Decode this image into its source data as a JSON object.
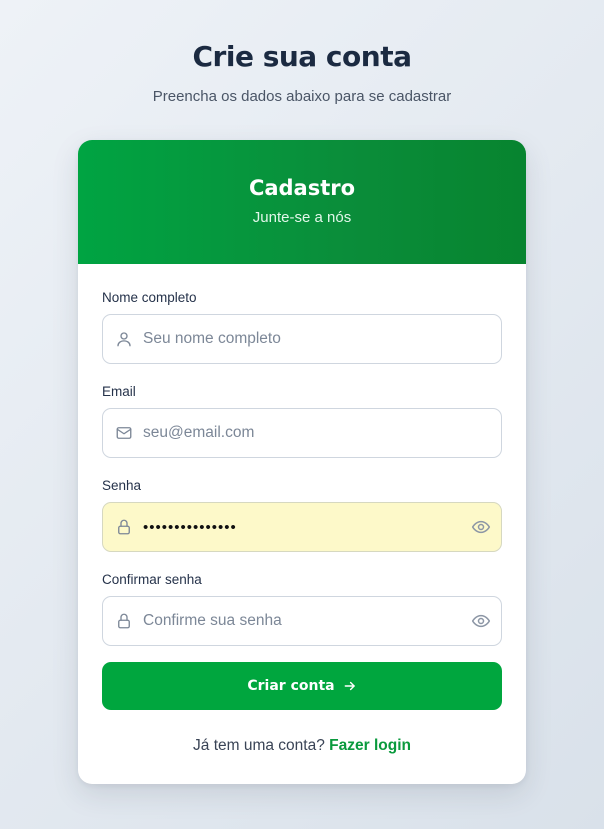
{
  "page": {
    "title": "Crie sua conta",
    "subtitle": "Preencha os dados abaixo para se cadastrar"
  },
  "card": {
    "title": "Cadastro",
    "subtitle": "Junte-se a nós"
  },
  "form": {
    "name": {
      "label": "Nome completo",
      "placeholder": "Seu nome completo",
      "value": ""
    },
    "email": {
      "label": "Email",
      "placeholder": "seu@email.com",
      "value": ""
    },
    "password": {
      "label": "Senha",
      "placeholder": "",
      "value": "•••••••••••••••"
    },
    "confirm_password": {
      "label": "Confirmar senha",
      "placeholder": "Confirme sua senha",
      "value": ""
    },
    "submit_label": "Criar conta"
  },
  "footer": {
    "prompt": "Já tem uma conta?",
    "login_link": "Fazer login"
  },
  "icons": {
    "name": "user-icon",
    "email": "mail-icon",
    "password": "lock-icon",
    "confirm_password": "lock-icon",
    "toggle": "eye-icon",
    "submit": "arrow-right-icon"
  },
  "colors": {
    "primary": "#00a63e",
    "header_gradient_start": "#00a442",
    "header_gradient_end": "#07842f",
    "autofill_bg": "#fdf9c9",
    "link": "#0a9a3d"
  }
}
